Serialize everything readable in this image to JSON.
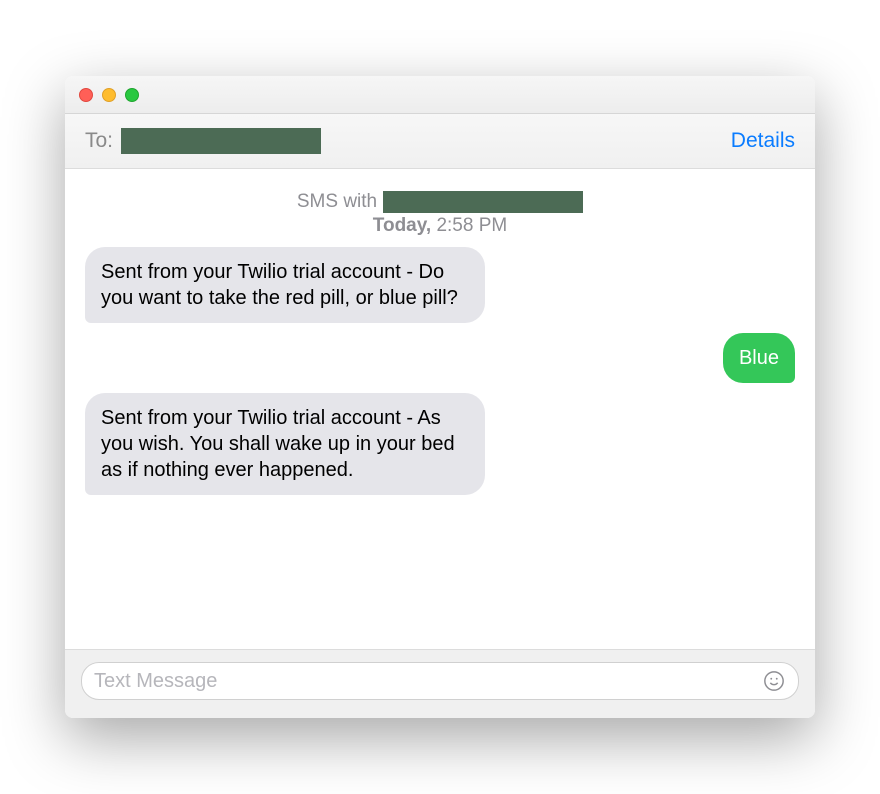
{
  "header": {
    "to_label": "To:",
    "details_label": "Details"
  },
  "meta": {
    "sms_with_prefix": "SMS with",
    "timestamp_day": "Today,",
    "timestamp_time": " 2:58 PM"
  },
  "messages": [
    {
      "direction": "incoming",
      "text": "Sent from your Twilio trial account - Do you want to take the red pill, or blue pill?"
    },
    {
      "direction": "outgoing",
      "text": "Blue"
    },
    {
      "direction": "incoming",
      "text": "Sent from your Twilio trial account - As you wish. You shall wake up in your bed as if nothing ever happened."
    }
  ],
  "input": {
    "placeholder": "Text Message"
  }
}
